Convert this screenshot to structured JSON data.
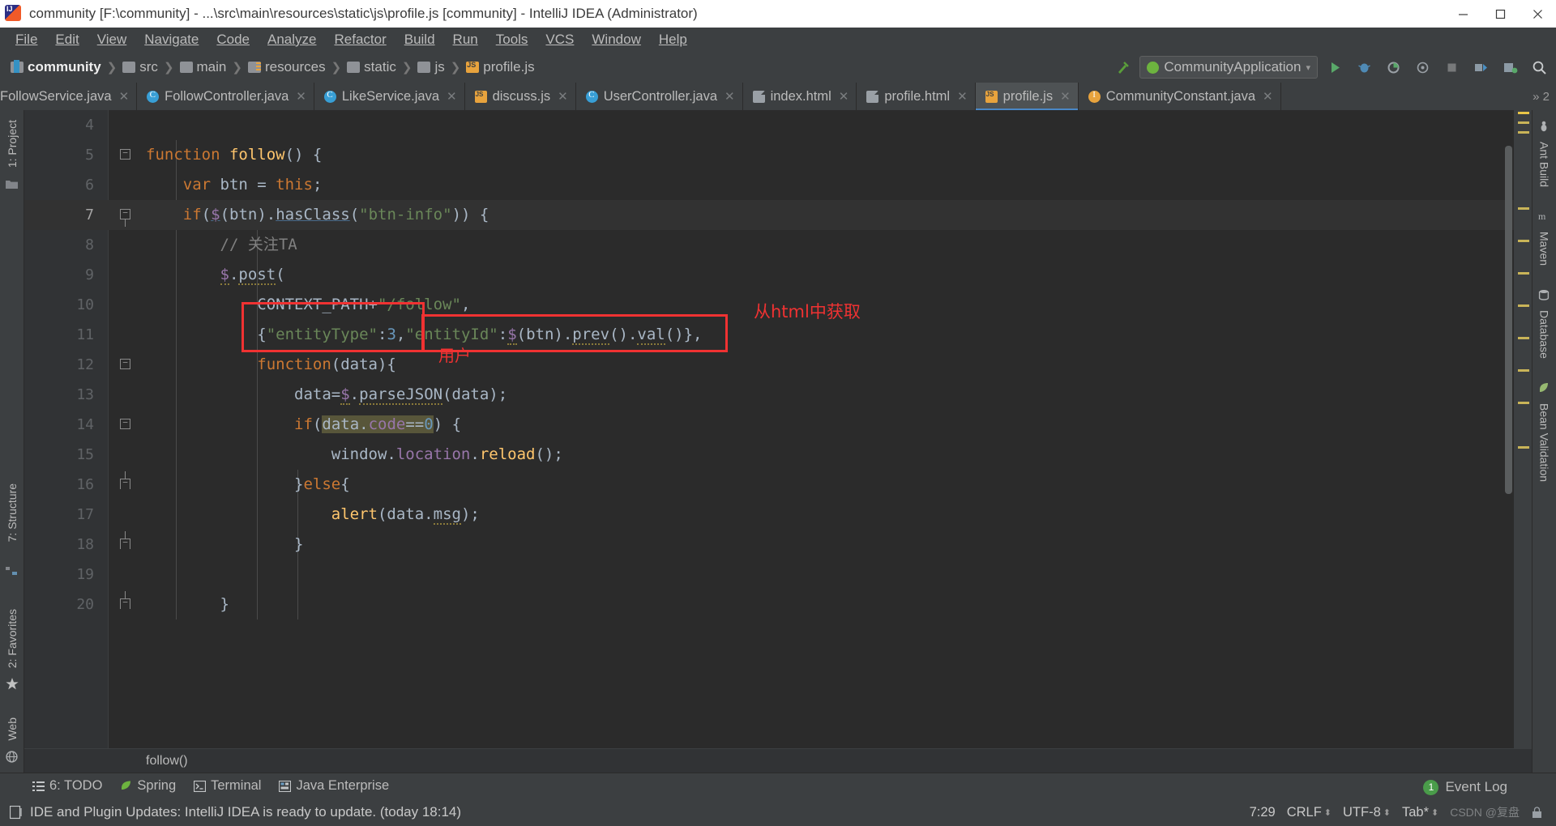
{
  "window": {
    "title": "community [F:\\community] - ...\\src\\main\\resources\\static\\js\\profile.js [community] - IntelliJ IDEA (Administrator)",
    "app_icon": "intellij-idea-icon",
    "controls": {
      "minimize": "minimize-icon",
      "maximize": "maximize-icon",
      "close": "close-icon"
    }
  },
  "menubar": [
    {
      "label": "File"
    },
    {
      "label": "Edit"
    },
    {
      "label": "View"
    },
    {
      "label": "Navigate"
    },
    {
      "label": "Code"
    },
    {
      "label": "Analyze"
    },
    {
      "label": "Refactor"
    },
    {
      "label": "Build"
    },
    {
      "label": "Run"
    },
    {
      "label": "Tools"
    },
    {
      "label": "VCS"
    },
    {
      "label": "Window"
    },
    {
      "label": "Help"
    }
  ],
  "breadcrumbs": [
    {
      "label": "community",
      "icon": "module-icon"
    },
    {
      "label": "src",
      "icon": "folder-icon"
    },
    {
      "label": "main",
      "icon": "folder-icon"
    },
    {
      "label": "resources",
      "icon": "resources-folder-icon"
    },
    {
      "label": "static",
      "icon": "folder-icon"
    },
    {
      "label": "js",
      "icon": "folder-icon"
    },
    {
      "label": "profile.js",
      "icon": "javascript-file-icon"
    }
  ],
  "toolbar": {
    "build_icon": "hammer-icon",
    "run_config": "CommunityApplication",
    "run_config_icon": "spring-boot-icon",
    "dropdown_icon": "chevron-down-icon",
    "run_button": "run-icon",
    "debug_button": "debug-icon",
    "run_coverage_button": "run-with-coverage-icon",
    "profile_button": "profile-icon",
    "stop_button": "stop-icon",
    "update_button": "update-project-icon",
    "commit_button": "commit-icon",
    "search_button": "search-everywhere-icon"
  },
  "tabs": [
    {
      "label": "FollowService.java",
      "icon": "java-class-icon",
      "active": false
    },
    {
      "label": "FollowController.java",
      "icon": "java-class-icon",
      "active": false
    },
    {
      "label": "LikeService.java",
      "icon": "java-class-icon",
      "active": false
    },
    {
      "label": "discuss.js",
      "icon": "javascript-file-icon",
      "active": false
    },
    {
      "label": "UserController.java",
      "icon": "java-class-icon",
      "active": false
    },
    {
      "label": "index.html",
      "icon": "html-file-icon",
      "active": false
    },
    {
      "label": "profile.html",
      "icon": "html-file-icon",
      "active": false
    },
    {
      "label": "profile.js",
      "icon": "javascript-file-icon",
      "active": true
    },
    {
      "label": "CommunityConstant.java",
      "icon": "java-interface-icon",
      "active": false
    }
  ],
  "tabs_overflow": "» 2",
  "left_tool_window_tabs": [
    {
      "label": "1: Project"
    },
    {
      "label": "7: Structure"
    },
    {
      "label": "2: Favorites"
    },
    {
      "label": "Web"
    }
  ],
  "right_tool_window_tabs": [
    {
      "label": "Ant Build"
    },
    {
      "label": "Maven"
    },
    {
      "label": "Database"
    },
    {
      "label": "Bean Validation"
    }
  ],
  "editor": {
    "first_line_number": 4,
    "current_line": 7,
    "lines": [
      {
        "num": 4,
        "text": ""
      },
      {
        "num": 5,
        "text": "function follow() {"
      },
      {
        "num": 6,
        "text": "    var btn = this;"
      },
      {
        "num": 7,
        "text": "    if($(btn).hasClass(\"btn-info\")) {"
      },
      {
        "num": 8,
        "text": "        // 关注TA"
      },
      {
        "num": 9,
        "text": "        $.post("
      },
      {
        "num": 10,
        "text": "            CONTEXT_PATH+\"/follow\","
      },
      {
        "num": 11,
        "text": "            {\"entityType\":3,\"entityId\":$(btn).prev().val()},"
      },
      {
        "num": 12,
        "text": "            function(data){"
      },
      {
        "num": 13,
        "text": "                data=$.parseJSON(data);"
      },
      {
        "num": 14,
        "text": "                if(data.code==0) {"
      },
      {
        "num": 15,
        "text": "                    window.location.reload();"
      },
      {
        "num": 16,
        "text": "                }else{"
      },
      {
        "num": 17,
        "text": "                    alert(data.msg);"
      },
      {
        "num": 18,
        "text": "                }"
      },
      {
        "num": 19,
        "text": ""
      },
      {
        "num": 20,
        "text": "        }"
      }
    ],
    "breadcrumb": "follow()"
  },
  "annotations": {
    "box_color": "#f03232",
    "labels": [
      {
        "text": "从html中获取"
      },
      {
        "text": "用户"
      }
    ]
  },
  "bottom_tool_windows": [
    {
      "label": "6: TODO",
      "mnemonic": "6",
      "icon": "todo-icon"
    },
    {
      "label": "Spring",
      "icon": "spring-icon"
    },
    {
      "label": "Terminal",
      "icon": "terminal-icon"
    },
    {
      "label": "Java Enterprise",
      "icon": "java-enterprise-icon"
    }
  ],
  "statusbar": {
    "message": "IDE and Plugin Updates: IntelliJ IDEA is ready to update. (today 18:14)",
    "message_icon": "notification-icon",
    "event_log": "Event Log",
    "event_log_count": "1",
    "caret_position": "7:29",
    "line_separator": "CRLF",
    "encoding": "UTF-8",
    "indent": "Tab*",
    "watermark": "CSDN @复盘"
  }
}
